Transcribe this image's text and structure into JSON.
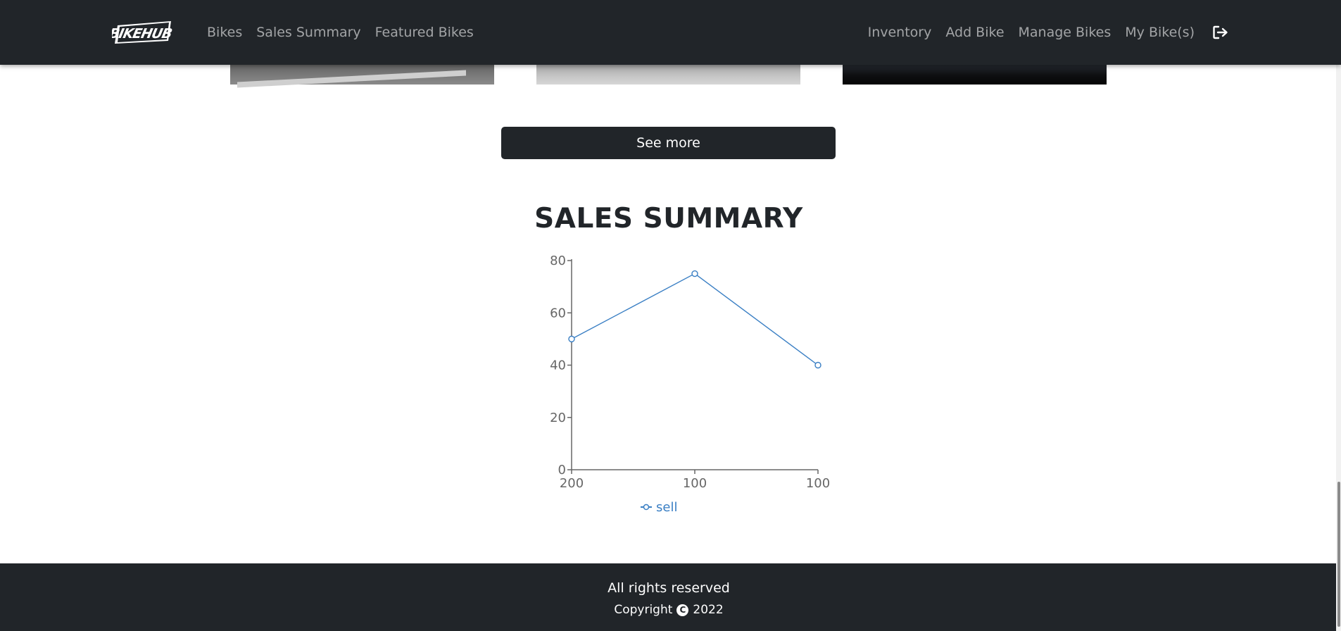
{
  "navbar": {
    "brand_text": "BIKEHUB",
    "left_links": [
      "Bikes",
      "Sales Summary",
      "Featured Bikes"
    ],
    "right_links": [
      "Inventory",
      "Add Bike",
      "Manage Bikes",
      "My Bike(s)"
    ],
    "logout_icon": "logout-icon",
    "background_color": "#212529"
  },
  "see_more": {
    "label": "See more"
  },
  "sales_summary": {
    "title": "SALES SUMMARY"
  },
  "chart_data": {
    "type": "line",
    "categories": [
      "200",
      "100",
      "100"
    ],
    "series": [
      {
        "name": "sell",
        "values": [
          50,
          75,
          40
        ],
        "color": "#3a7fc4"
      }
    ],
    "yticks": [
      0,
      20,
      40,
      60,
      80
    ],
    "ylim": [
      0,
      80
    ],
    "legend": "bottom-center",
    "grid": false
  },
  "footer": {
    "line1": "All rights reserved",
    "copyright_word": "Copyright",
    "copyright_icon": "copyright-icon",
    "year": "2022"
  }
}
